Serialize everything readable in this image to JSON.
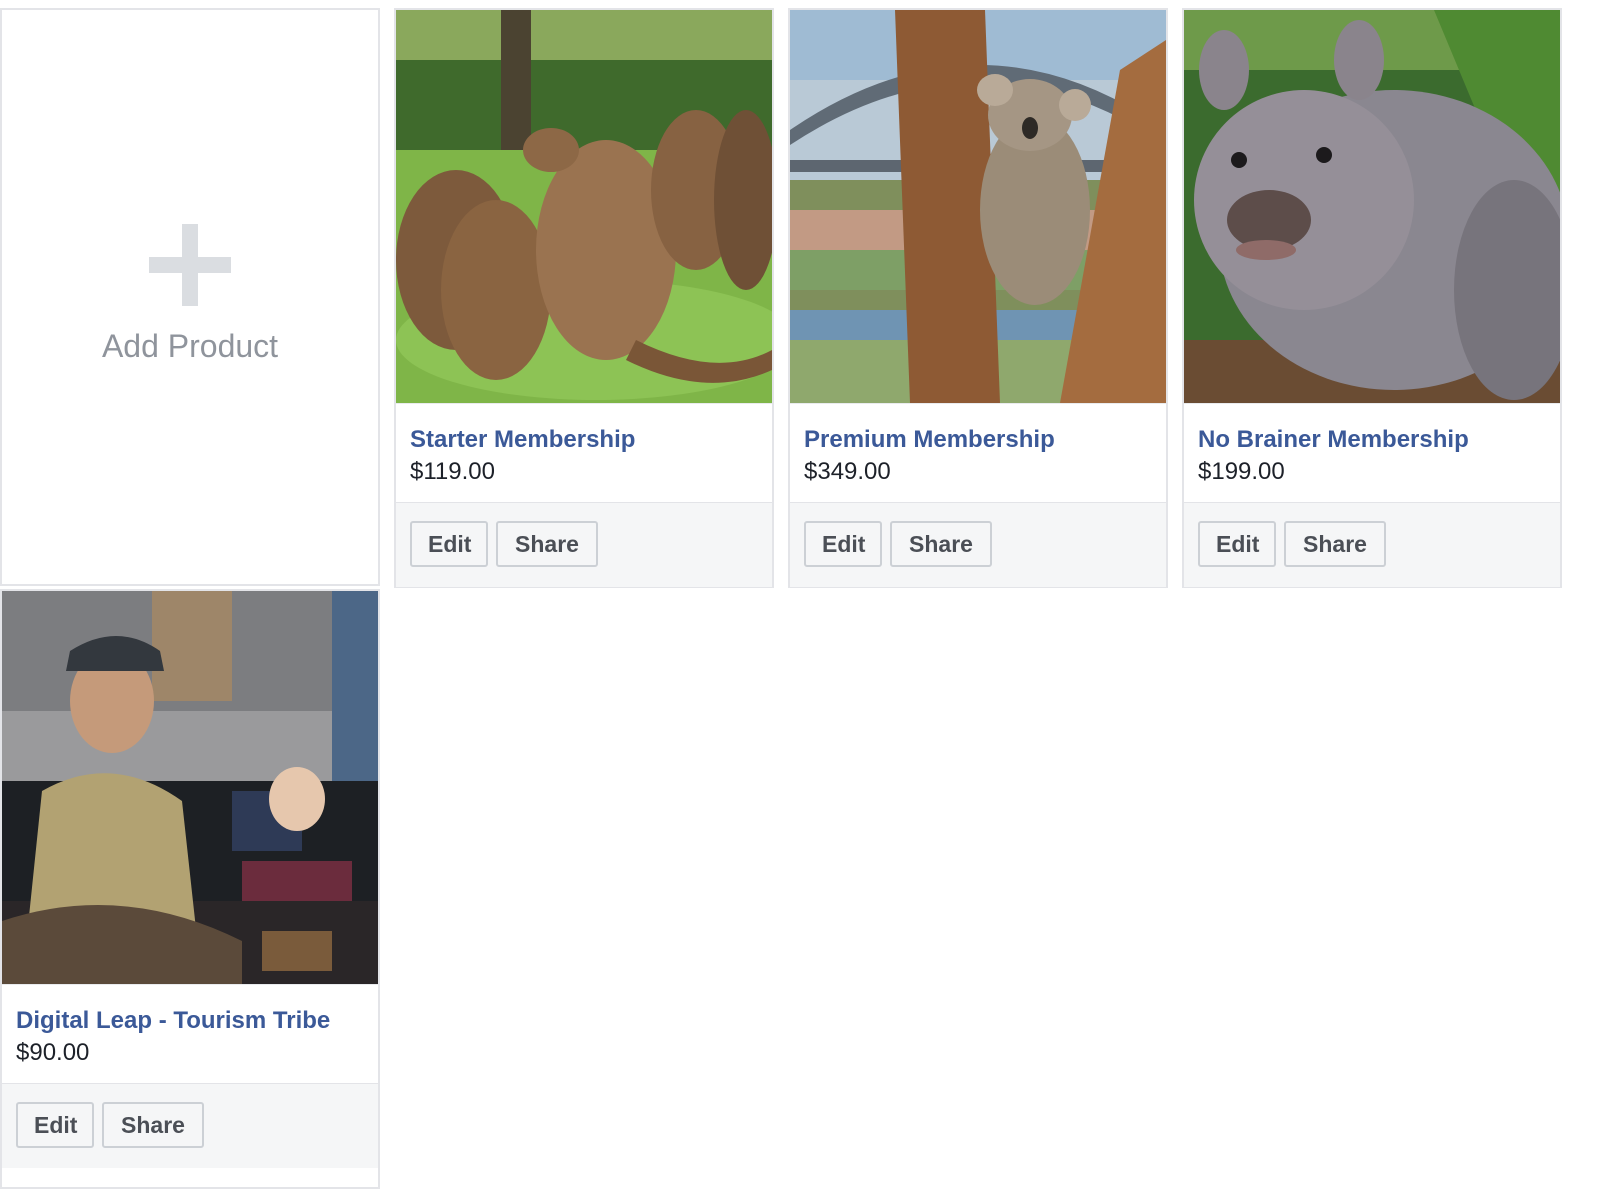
{
  "add_product": {
    "label": "Add Product",
    "icon": "plus-icon"
  },
  "products": [
    {
      "title": "Starter Membership",
      "price": "$119.00",
      "edit_label": "Edit",
      "share_label": "Share",
      "image": "kangaroo-photo"
    },
    {
      "title": "Premium Membership",
      "price": "$349.00",
      "edit_label": "Edit",
      "share_label": "Share",
      "image": "koala-photo"
    },
    {
      "title": "No Brainer Membership",
      "price": "$199.00",
      "edit_label": "Edit",
      "share_label": "Share",
      "image": "wombat-photo"
    },
    {
      "title": "Digital Leap - Tourism Tribe",
      "price": "$90.00",
      "edit_label": "Edit",
      "share_label": "Share",
      "image": "expo-booth-photo"
    }
  ],
  "colors": {
    "title": "#3b5998",
    "price": "#1d2129",
    "button_text": "#4b4f56",
    "footer_bg": "#f5f6f7",
    "border": "#e3e4e8"
  }
}
